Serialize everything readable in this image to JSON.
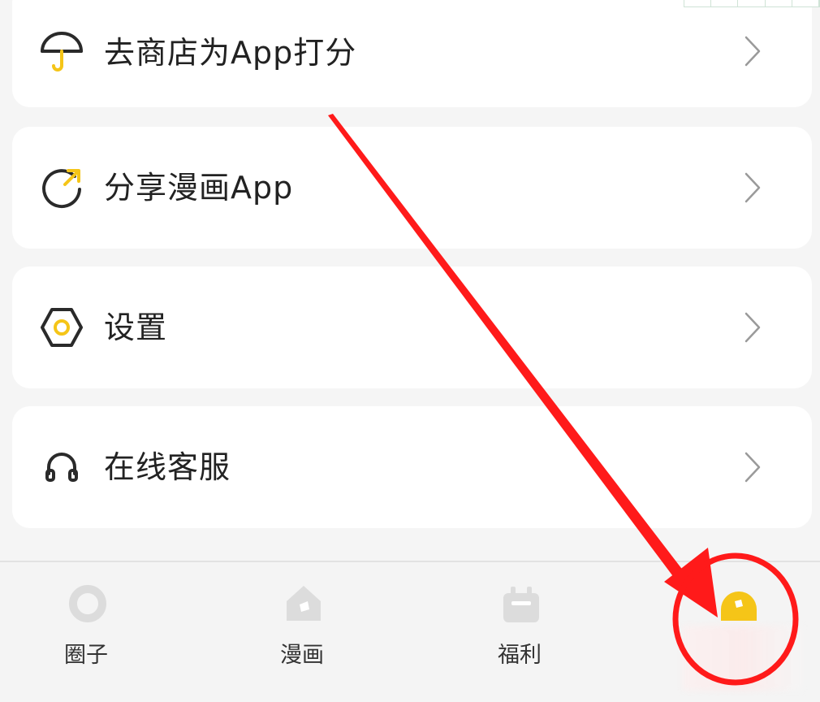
{
  "menu": {
    "items": [
      {
        "label": "去商店为App打分",
        "icon": "umbrella-icon"
      },
      {
        "label": "分享漫画App",
        "icon": "share-arrow-icon"
      },
      {
        "label": "设置",
        "icon": "hexagon-settings-icon"
      },
      {
        "label": "在线客服",
        "icon": "headphones-icon"
      }
    ]
  },
  "tabbar": {
    "tabs": [
      {
        "label": "圈子",
        "icon": "circle-ring-icon"
      },
      {
        "label": "漫画",
        "icon": "house-icon"
      },
      {
        "label": "福利",
        "icon": "gift-box-icon"
      },
      {
        "label": "",
        "icon": "profile-icon"
      }
    ]
  },
  "colors": {
    "accent": "#f5c518",
    "icon_stroke": "#2a2a2a",
    "chevron": "#9a9a9a",
    "annotation": "#ff1a1a",
    "card_bg": "#ffffff",
    "page_bg": "#f5f5f5"
  }
}
